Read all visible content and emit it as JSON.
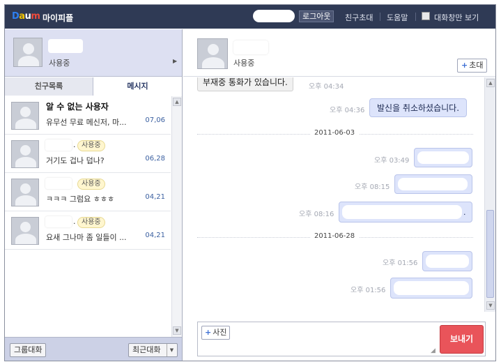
{
  "app": {
    "logo_d": "D",
    "logo_a": "a",
    "logo_u": "u",
    "logo_m": "m",
    "title": "마이피플"
  },
  "header": {
    "logout": "로그아웃",
    "invite_friend": "친구초대",
    "help": "도움말",
    "chat_only_view": "대화창만 보기"
  },
  "me": {
    "status": "사용중"
  },
  "tabs": {
    "friends": "친구목록",
    "messages": "메시지"
  },
  "conversations": [
    {
      "name": "알 수 없는 사용자",
      "preview": "유무선 무료 메신저, 마...",
      "date": "07,06"
    },
    {
      "name_suffix": ".",
      "status": "사용중",
      "preview": "거기도 겁나 덥나?",
      "date": "06,28"
    },
    {
      "name_suffix": "",
      "status": "사용중",
      "preview": "ㅋㅋㅋ 그럼요 ㅎㅎㅎ",
      "date": "04,21"
    },
    {
      "name_suffix": ".",
      "status": "사용중",
      "preview": "요새 그나마 좀 일들이 ...",
      "date": "04,21"
    }
  ],
  "left_footer": {
    "group_chat": "그룹대화",
    "recent_chat": "최근대화"
  },
  "peer": {
    "status": "사용중",
    "invite": "초대"
  },
  "chat": {
    "messages": [
      {
        "type": "received",
        "text": "부재중 통화가 있습니다.",
        "time": "오후 04:34"
      },
      {
        "type": "sent",
        "text": "발신을 취소하셨습니다.",
        "time": "오후 04:36"
      },
      {
        "type": "date",
        "text": "2011-06-03"
      },
      {
        "type": "sent",
        "text": "",
        "time": "오후 03:49"
      },
      {
        "type": "sent",
        "text": "",
        "time": "오후 08:15"
      },
      {
        "type": "sent",
        "text": ".",
        "time": "오후 08:16"
      },
      {
        "type": "date",
        "text": "2011-06-28"
      },
      {
        "type": "sent",
        "text": "",
        "time": "오후 01:56"
      },
      {
        "type": "sent",
        "text": "",
        "time": "오후 01:56"
      }
    ]
  },
  "compose": {
    "photo": "사진",
    "send": "보내기"
  },
  "colors": {
    "header_bg": "#2f3a55",
    "send_button": "#e9545a",
    "sent_bubble": "#dde4fb"
  }
}
